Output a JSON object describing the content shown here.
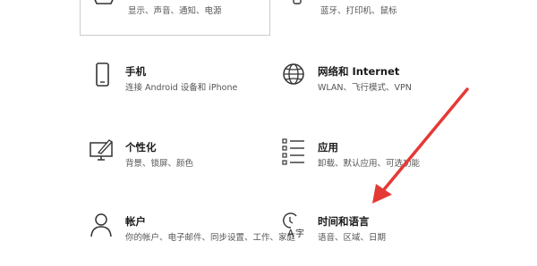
{
  "tiles": [
    {
      "key": "system",
      "title": "",
      "desc": "显示、声音、通知、电源"
    },
    {
      "key": "devices",
      "title": "",
      "desc": "蓝牙、打印机、鼠标"
    },
    {
      "key": "phone",
      "title": "手机",
      "desc": "连接 Android 设备和 iPhone"
    },
    {
      "key": "network",
      "title": "网络和 Internet",
      "desc": "WLAN、飞行模式、VPN"
    },
    {
      "key": "personalization",
      "title": "个性化",
      "desc": "背景、锁屏、颜色"
    },
    {
      "key": "apps",
      "title": "应用",
      "desc": "卸载、默认应用、可选功能"
    },
    {
      "key": "accounts",
      "title": "帐户",
      "desc": "你的帐户、电子邮件、同步设置、工作、家庭"
    },
    {
      "key": "time-language",
      "title": "时间和语言",
      "desc": "语音、区域、日期"
    }
  ],
  "colors": {
    "arrow": "#e53935",
    "icon": "#333333",
    "border": "#cccccc"
  }
}
